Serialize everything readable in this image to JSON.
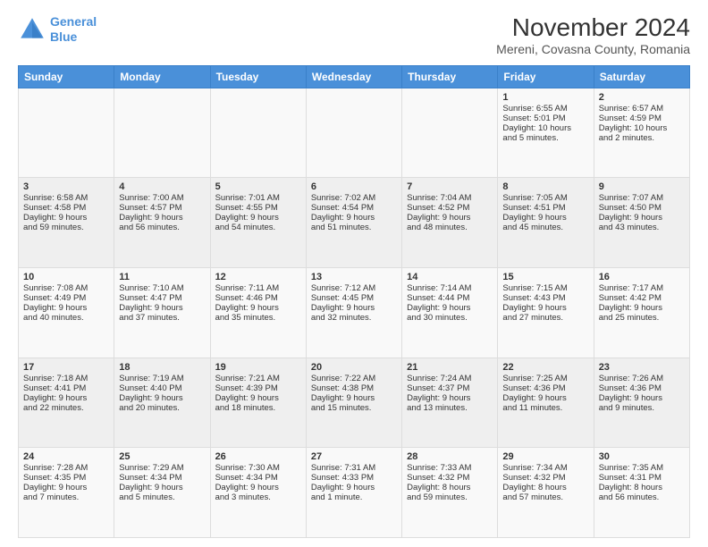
{
  "header": {
    "logo_line1": "General",
    "logo_line2": "Blue",
    "title": "November 2024",
    "subtitle": "Mereni, Covasna County, Romania"
  },
  "days_of_week": [
    "Sunday",
    "Monday",
    "Tuesday",
    "Wednesday",
    "Thursday",
    "Friday",
    "Saturday"
  ],
  "weeks": [
    [
      {
        "day": "",
        "info": ""
      },
      {
        "day": "",
        "info": ""
      },
      {
        "day": "",
        "info": ""
      },
      {
        "day": "",
        "info": ""
      },
      {
        "day": "",
        "info": ""
      },
      {
        "day": "1",
        "info": "Sunrise: 6:55 AM\nSunset: 5:01 PM\nDaylight: 10 hours\nand 5 minutes."
      },
      {
        "day": "2",
        "info": "Sunrise: 6:57 AM\nSunset: 4:59 PM\nDaylight: 10 hours\nand 2 minutes."
      }
    ],
    [
      {
        "day": "3",
        "info": "Sunrise: 6:58 AM\nSunset: 4:58 PM\nDaylight: 9 hours\nand 59 minutes."
      },
      {
        "day": "4",
        "info": "Sunrise: 7:00 AM\nSunset: 4:57 PM\nDaylight: 9 hours\nand 56 minutes."
      },
      {
        "day": "5",
        "info": "Sunrise: 7:01 AM\nSunset: 4:55 PM\nDaylight: 9 hours\nand 54 minutes."
      },
      {
        "day": "6",
        "info": "Sunrise: 7:02 AM\nSunset: 4:54 PM\nDaylight: 9 hours\nand 51 minutes."
      },
      {
        "day": "7",
        "info": "Sunrise: 7:04 AM\nSunset: 4:52 PM\nDaylight: 9 hours\nand 48 minutes."
      },
      {
        "day": "8",
        "info": "Sunrise: 7:05 AM\nSunset: 4:51 PM\nDaylight: 9 hours\nand 45 minutes."
      },
      {
        "day": "9",
        "info": "Sunrise: 7:07 AM\nSunset: 4:50 PM\nDaylight: 9 hours\nand 43 minutes."
      }
    ],
    [
      {
        "day": "10",
        "info": "Sunrise: 7:08 AM\nSunset: 4:49 PM\nDaylight: 9 hours\nand 40 minutes."
      },
      {
        "day": "11",
        "info": "Sunrise: 7:10 AM\nSunset: 4:47 PM\nDaylight: 9 hours\nand 37 minutes."
      },
      {
        "day": "12",
        "info": "Sunrise: 7:11 AM\nSunset: 4:46 PM\nDaylight: 9 hours\nand 35 minutes."
      },
      {
        "day": "13",
        "info": "Sunrise: 7:12 AM\nSunset: 4:45 PM\nDaylight: 9 hours\nand 32 minutes."
      },
      {
        "day": "14",
        "info": "Sunrise: 7:14 AM\nSunset: 4:44 PM\nDaylight: 9 hours\nand 30 minutes."
      },
      {
        "day": "15",
        "info": "Sunrise: 7:15 AM\nSunset: 4:43 PM\nDaylight: 9 hours\nand 27 minutes."
      },
      {
        "day": "16",
        "info": "Sunrise: 7:17 AM\nSunset: 4:42 PM\nDaylight: 9 hours\nand 25 minutes."
      }
    ],
    [
      {
        "day": "17",
        "info": "Sunrise: 7:18 AM\nSunset: 4:41 PM\nDaylight: 9 hours\nand 22 minutes."
      },
      {
        "day": "18",
        "info": "Sunrise: 7:19 AM\nSunset: 4:40 PM\nDaylight: 9 hours\nand 20 minutes."
      },
      {
        "day": "19",
        "info": "Sunrise: 7:21 AM\nSunset: 4:39 PM\nDaylight: 9 hours\nand 18 minutes."
      },
      {
        "day": "20",
        "info": "Sunrise: 7:22 AM\nSunset: 4:38 PM\nDaylight: 9 hours\nand 15 minutes."
      },
      {
        "day": "21",
        "info": "Sunrise: 7:24 AM\nSunset: 4:37 PM\nDaylight: 9 hours\nand 13 minutes."
      },
      {
        "day": "22",
        "info": "Sunrise: 7:25 AM\nSunset: 4:36 PM\nDaylight: 9 hours\nand 11 minutes."
      },
      {
        "day": "23",
        "info": "Sunrise: 7:26 AM\nSunset: 4:36 PM\nDaylight: 9 hours\nand 9 minutes."
      }
    ],
    [
      {
        "day": "24",
        "info": "Sunrise: 7:28 AM\nSunset: 4:35 PM\nDaylight: 9 hours\nand 7 minutes."
      },
      {
        "day": "25",
        "info": "Sunrise: 7:29 AM\nSunset: 4:34 PM\nDaylight: 9 hours\nand 5 minutes."
      },
      {
        "day": "26",
        "info": "Sunrise: 7:30 AM\nSunset: 4:34 PM\nDaylight: 9 hours\nand 3 minutes."
      },
      {
        "day": "27",
        "info": "Sunrise: 7:31 AM\nSunset: 4:33 PM\nDaylight: 9 hours\nand 1 minute."
      },
      {
        "day": "28",
        "info": "Sunrise: 7:33 AM\nSunset: 4:32 PM\nDaylight: 8 hours\nand 59 minutes."
      },
      {
        "day": "29",
        "info": "Sunrise: 7:34 AM\nSunset: 4:32 PM\nDaylight: 8 hours\nand 57 minutes."
      },
      {
        "day": "30",
        "info": "Sunrise: 7:35 AM\nSunset: 4:31 PM\nDaylight: 8 hours\nand 56 minutes."
      }
    ]
  ]
}
